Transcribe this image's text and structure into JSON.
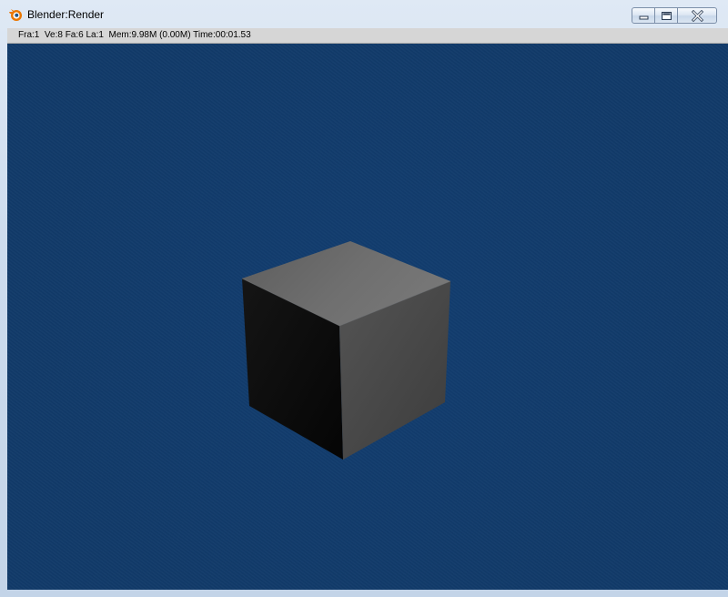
{
  "window": {
    "title": "Blender:Render",
    "icon": "blender-logo-icon"
  },
  "caption_buttons": {
    "minimize": "minimize-icon",
    "maximize": "maximize-icon",
    "close": "close-icon"
  },
  "status": {
    "text": "Fra:1  Ve:8 Fa:6 La:1  Mem:9.98M (0.00M) Time:00:01.53"
  },
  "render": {
    "background_color": "#113a69",
    "object": "cube"
  },
  "colors": {
    "cube_top": "#6b6b6b",
    "cube_left": "#0b0b0b",
    "cube_right": "#4a4a4a"
  }
}
